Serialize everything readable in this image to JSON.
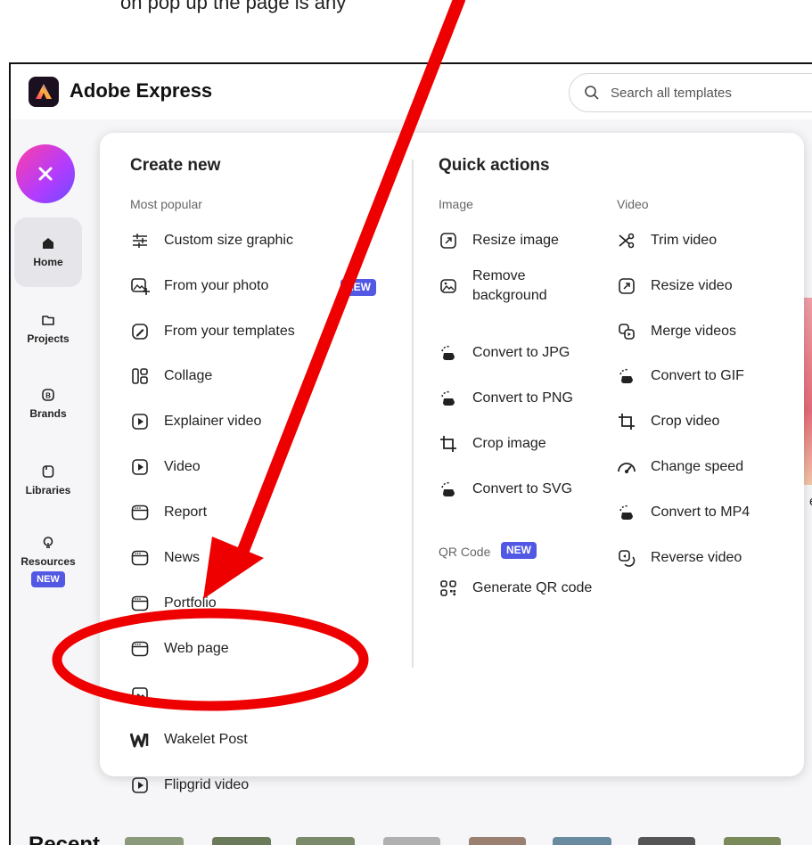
{
  "caption": "on pop up the page is any",
  "app": {
    "title": "Adobe Express"
  },
  "search": {
    "placeholder": "Search all templates"
  },
  "rail": {
    "items": [
      {
        "label": "Home",
        "icon": "home-icon",
        "active": true
      },
      {
        "label": "Projects",
        "icon": "folder-icon"
      },
      {
        "label": "Brands",
        "icon": "brand-icon"
      },
      {
        "label": "Libraries",
        "icon": "library-icon"
      },
      {
        "label": "Resources",
        "icon": "lightbulb-icon",
        "badge": "NEW"
      }
    ]
  },
  "create_new": {
    "title": "Create new",
    "subtitle": "Most popular",
    "items": [
      {
        "label": "Custom size graphic",
        "icon": "sliders-icon"
      },
      {
        "label": "From your photo",
        "icon": "photo-add-icon",
        "badge": "NEW"
      },
      {
        "label": "From your templates",
        "icon": "template-edit-icon"
      },
      {
        "label": "Collage",
        "icon": "collage-icon"
      },
      {
        "label": "Explainer video",
        "icon": "play-icon"
      },
      {
        "label": "Video",
        "icon": "play-icon"
      },
      {
        "label": "Report",
        "icon": "webpage-icon"
      },
      {
        "label": "News",
        "icon": "webpage-icon"
      },
      {
        "label": "Portfolio",
        "icon": "webpage-icon"
      },
      {
        "label": "Web page",
        "icon": "webpage-icon"
      },
      {
        "label": "",
        "icon": "image-icon"
      },
      {
        "label": "Wakelet Post",
        "icon": "wakelet-icon"
      },
      {
        "label": "Flipgrid video",
        "icon": "play-icon"
      }
    ]
  },
  "quick_actions": {
    "title": "Quick actions",
    "image_label": "Image",
    "video_label": "Video",
    "image_items": [
      {
        "label": "Resize image",
        "icon": "resize-icon"
      },
      {
        "label": "Remove\nbackground",
        "line1": "Remove",
        "line2": "background",
        "icon": "remove-bg-icon"
      },
      {
        "label": "Convert to JPG",
        "icon": "convert-icon"
      },
      {
        "label": "Convert to PNG",
        "icon": "convert-icon"
      },
      {
        "label": "Crop image",
        "icon": "crop-icon"
      },
      {
        "label": "Convert to SVG",
        "icon": "convert-icon"
      }
    ],
    "video_items": [
      {
        "label": "Trim video",
        "icon": "scissors-icon"
      },
      {
        "label": "Resize video",
        "icon": "resize-icon"
      },
      {
        "label": "Merge videos",
        "icon": "merge-icon"
      },
      {
        "label": "Convert to GIF",
        "icon": "convert-icon"
      },
      {
        "label": "Crop video",
        "icon": "crop-icon"
      },
      {
        "label": "Change speed",
        "icon": "speed-icon"
      },
      {
        "label": "Convert to MP4",
        "icon": "convert-icon"
      },
      {
        "label": "Reverse video",
        "icon": "reverse-icon"
      }
    ],
    "qr_label": "QR Code",
    "qr_badge": "NEW",
    "qr_items": [
      {
        "label": "Generate QR code",
        "icon": "qr-icon"
      }
    ]
  },
  "recent": {
    "title": "Recent"
  },
  "side_snippet": "er",
  "colors": {
    "accent_badge": "#5258e4",
    "annotation_red": "#ee0000",
    "fab_gradient": [
      "#ff3ea5",
      "#b13cff",
      "#6a4cff"
    ]
  }
}
